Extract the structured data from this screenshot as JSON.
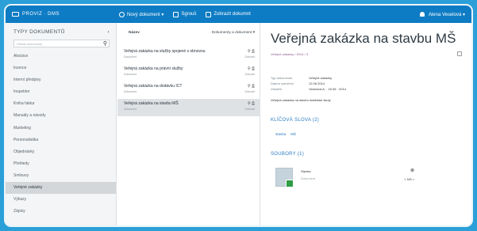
{
  "header": {
    "brand": "PROVIZ · DMS",
    "actions": [
      {
        "label": "Nový dokument ▾",
        "icon": "plus-icon"
      },
      {
        "label": "Sgrouš",
        "icon": "folder-icon"
      },
      {
        "label": "Zobrazit dokumnt",
        "icon": "document-icon"
      }
    ],
    "user": "Alena Veselová ▾"
  },
  "sidebar": {
    "title": "TYPY DOKUMENTŮ",
    "collapse_glyph": "‹",
    "search_placeholder": "Hledat dokumenty",
    "search_icon": "search-icon",
    "items": [
      {
        "label": "Akvizice"
      },
      {
        "label": "Inzerce"
      },
      {
        "label": "Interní předpisy"
      },
      {
        "label": "Inspektor"
      },
      {
        "label": "Kniha faktur"
      },
      {
        "label": "Manuály a návody"
      },
      {
        "label": "Marketing"
      },
      {
        "label": "Personalistika"
      },
      {
        "label": "Objednávky"
      },
      {
        "label": "Přehledy"
      },
      {
        "label": "Smlouvy"
      },
      {
        "label": "Veřejné zakázky",
        "active": true
      },
      {
        "label": "Výkazy"
      },
      {
        "label": "Zápisy"
      }
    ]
  },
  "list": {
    "sort_label": "Název",
    "filter_label": "Dokumenty a dokument ▾",
    "rows": [
      {
        "name": "Veřejná zakázka na služby spojené s obnovou",
        "sub": "Dokument",
        "icons": "⚲ ⎙",
        "meta": "Zobrazit"
      },
      {
        "name": "Veřejná zakázka na právní služby",
        "sub": "Dokument",
        "icons": "⚲ ⎙",
        "meta": "Zobrazit"
      },
      {
        "name": "Veřejná zakázka na dodávku ICT",
        "sub": "Dokument",
        "icons": "⚲ ⎙",
        "meta": "Zobrazit"
      },
      {
        "name": "Veřejná zakázka na stavbu MŠ",
        "sub": "Dokument",
        "icons": "⚲ ⎙",
        "meta": "Zobrazit",
        "selected": true
      }
    ]
  },
  "detail": {
    "title": "Veřejná zakázka na stavbu MŠ",
    "subtitle": "Veřejné zakázky / 2014 / 3",
    "properties": [
      {
        "key": "Typ dokumentu",
        "value": "Veřejné zakázky"
      },
      {
        "key": "Datum vytvoření",
        "value": "12.06.2014"
      },
      {
        "key": "Vlastník",
        "value": "Veselová A. · 15:45 · 2014"
      }
    ],
    "description": "Veřejná zakázka na stavbu mateřské školy",
    "keywords_title": "KLÍČOVÁ SLOVA (2)",
    "keywords": [
      "stavba",
      "MŠ"
    ],
    "attachments_title": "SOUBORY (1)",
    "attachment": {
      "name": "Stavba",
      "sub": "Dokument",
      "size": "1 MB",
      "icon": "document-thumbnail-icon",
      "remove_glyph": "⊗",
      "download_glyph": "⌕"
    }
  },
  "colors": {
    "topbar": "#0e7cc4",
    "accent": "#2b7cc3",
    "border": "#2a9fd8",
    "selected_row": "#dfe2e5",
    "active_sidebar": "#d3d7da"
  }
}
